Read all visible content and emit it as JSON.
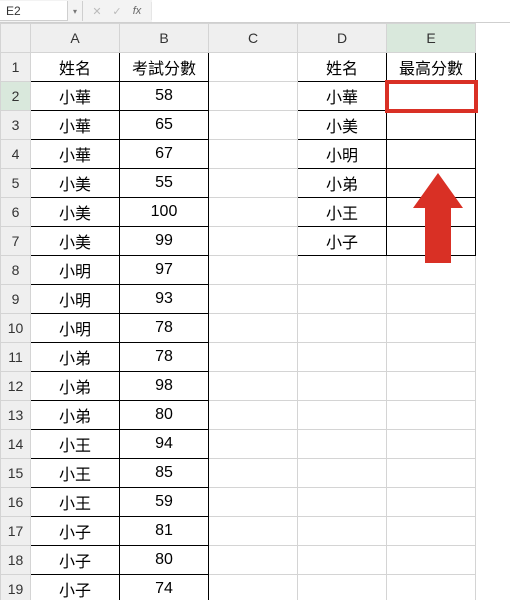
{
  "namebox": {
    "ref": "E2"
  },
  "columns": [
    "A",
    "B",
    "C",
    "D",
    "E"
  ],
  "rows": [
    "1",
    "2",
    "3",
    "4",
    "5",
    "6",
    "7",
    "8",
    "9",
    "10",
    "11",
    "12",
    "13",
    "14",
    "15",
    "16",
    "17",
    "18",
    "19"
  ],
  "headersAB": {
    "name": "姓名",
    "score": "考試分數"
  },
  "headersDE": {
    "name": "姓名",
    "max": "最高分數"
  },
  "dataAB": [
    {
      "n": "小華",
      "s": "58"
    },
    {
      "n": "小華",
      "s": "65"
    },
    {
      "n": "小華",
      "s": "67"
    },
    {
      "n": "小美",
      "s": "55"
    },
    {
      "n": "小美",
      "s": "100"
    },
    {
      "n": "小美",
      "s": "99"
    },
    {
      "n": "小明",
      "s": "97"
    },
    {
      "n": "小明",
      "s": "93"
    },
    {
      "n": "小明",
      "s": "78"
    },
    {
      "n": "小弟",
      "s": "78"
    },
    {
      "n": "小弟",
      "s": "98"
    },
    {
      "n": "小弟",
      "s": "80"
    },
    {
      "n": "小王",
      "s": "94"
    },
    {
      "n": "小王",
      "s": "85"
    },
    {
      "n": "小王",
      "s": "59"
    },
    {
      "n": "小子",
      "s": "81"
    },
    {
      "n": "小子",
      "s": "80"
    },
    {
      "n": "小子",
      "s": "74"
    }
  ],
  "dataD": [
    "小華",
    "小美",
    "小明",
    "小弟",
    "小王",
    "小子"
  ],
  "selected": {
    "col": "E",
    "row": 2
  }
}
